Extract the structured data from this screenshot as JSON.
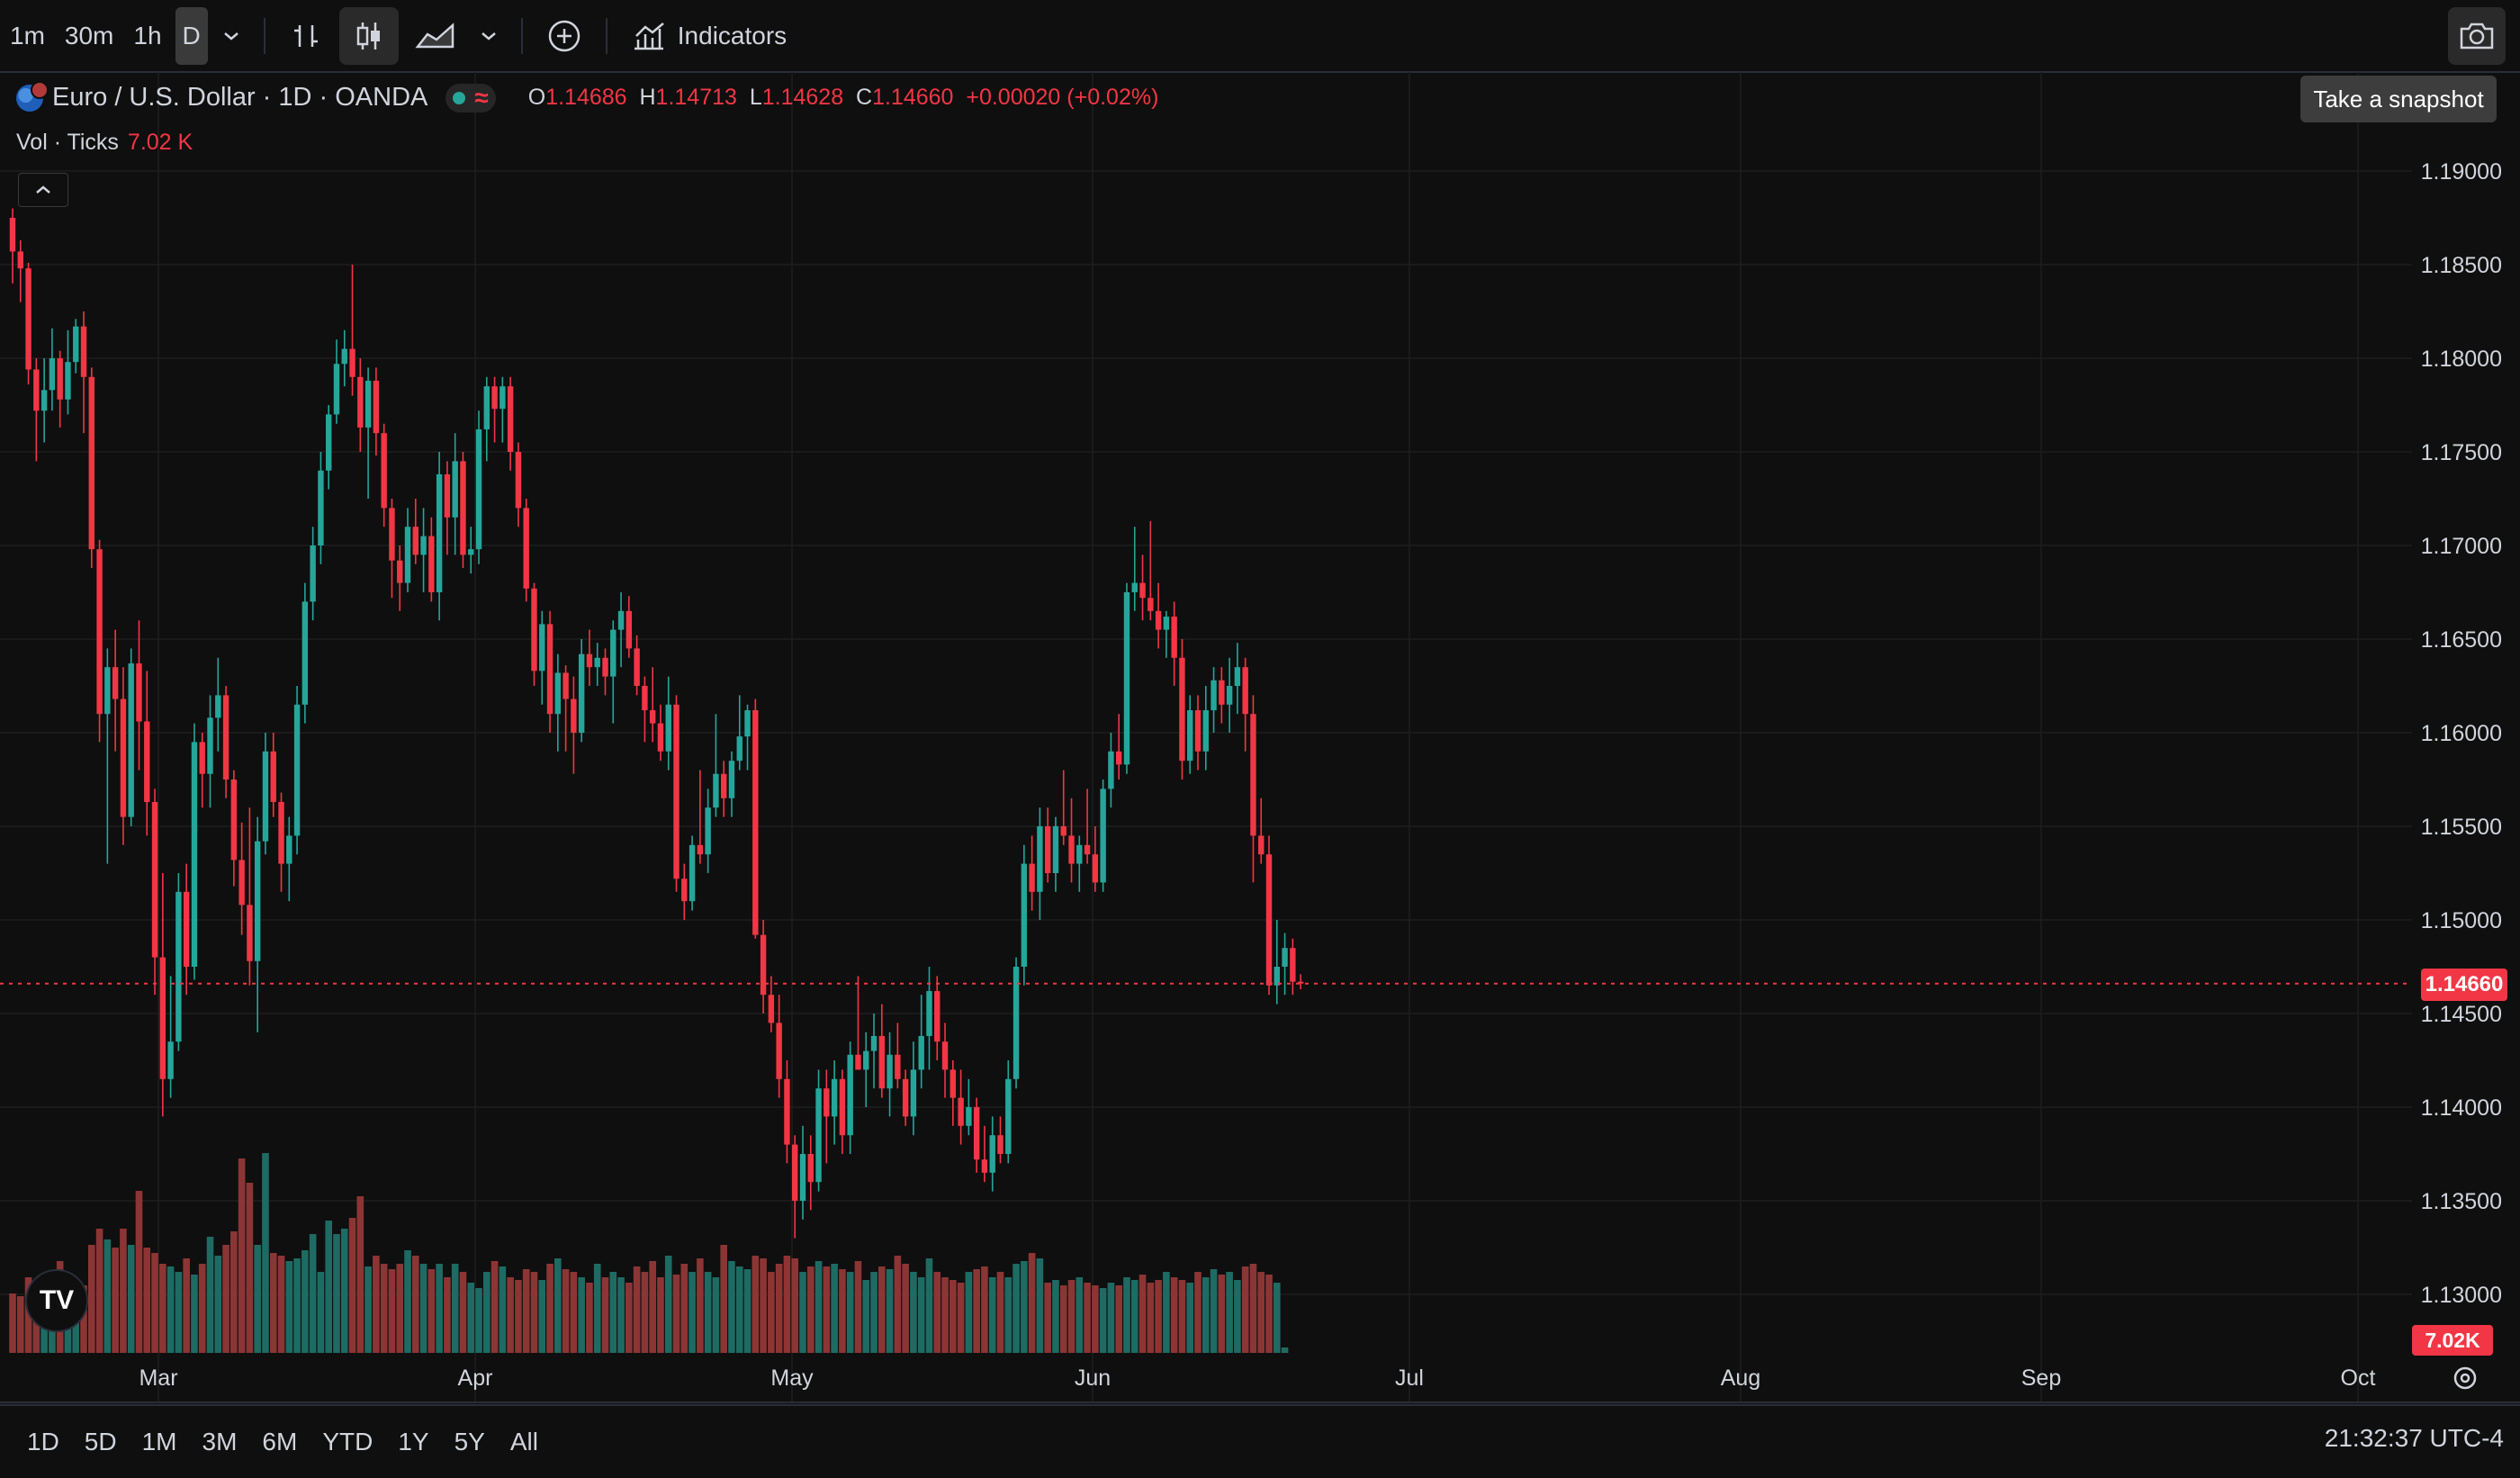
{
  "toolbar": {
    "timeframes": [
      "1m",
      "30m",
      "1h",
      "D"
    ],
    "indicators_label": "Indicators"
  },
  "snapshot_tooltip": "Take a snapshot",
  "legend": {
    "title": "Euro / U.S. Dollar · 1D · OANDA",
    "o_label": "O",
    "o": "1.14686",
    "h_label": "H",
    "h": "1.14713",
    "l_label": "L",
    "l": "1.14628",
    "c_label": "C",
    "c": "1.14660",
    "change": "+0.00020 (+0.02%)"
  },
  "volume_legend": {
    "label": "Vol · Ticks",
    "value": "7.02 K"
  },
  "price_axis": {
    "labels": [
      "1.19000",
      "1.18500",
      "1.18000",
      "1.17500",
      "1.17000",
      "1.16500",
      "1.16000",
      "1.15500",
      "1.15000",
      "1.14500",
      "1.14000",
      "1.13500",
      "1.13000"
    ],
    "last_price": "1.14660",
    "last_volume": "7.02K"
  },
  "time_axis": {
    "labels": [
      "Mar",
      "Apr",
      "May",
      "Jun",
      "Jul",
      "Aug",
      "Sep",
      "Oct"
    ]
  },
  "ranges": [
    "1D",
    "5D",
    "1M",
    "3M",
    "6M",
    "YTD",
    "1Y",
    "5Y",
    "All"
  ],
  "clock": "21:32:37 UTC-4",
  "tv_logo": "TV",
  "colors": {
    "up": "#26a69a",
    "down": "#f23645",
    "vol_up": "#1e6b63",
    "vol_down": "#8c3535",
    "grid": "#1e1e1e"
  },
  "chart_data": {
    "type": "candlestick",
    "symbol": "Euro / U.S. Dollar",
    "interval": "1D",
    "ylim": [
      1.128,
      1.192
    ],
    "y_ticks": [
      1.19,
      1.185,
      1.18,
      1.175,
      1.17,
      1.165,
      1.16,
      1.155,
      1.15,
      1.145,
      1.14,
      1.135,
      1.13
    ],
    "grid": true,
    "candles": [
      [
        1.1875,
        1.188,
        1.184,
        1.1857
      ],
      [
        1.1857,
        1.1863,
        1.183,
        1.1848
      ],
      [
        1.1848,
        1.1851,
        1.1786,
        1.1794
      ],
      [
        1.1794,
        1.18,
        1.1745,
        1.1772
      ],
      [
        1.1772,
        1.18,
        1.1755,
        1.1783
      ],
      [
        1.1783,
        1.1816,
        1.1772,
        1.18
      ],
      [
        1.18,
        1.1804,
        1.1763,
        1.1778
      ],
      [
        1.1778,
        1.1815,
        1.177,
        1.1798
      ],
      [
        1.1798,
        1.1821,
        1.1792,
        1.1817
      ],
      [
        1.1817,
        1.1825,
        1.176,
        1.179
      ],
      [
        1.179,
        1.1795,
        1.1688,
        1.1698
      ],
      [
        1.1698,
        1.1703,
        1.1595,
        1.161
      ],
      [
        1.161,
        1.1645,
        1.153,
        1.1635
      ],
      [
        1.1635,
        1.1655,
        1.159,
        1.1618
      ],
      [
        1.1618,
        1.1635,
        1.154,
        1.1555
      ],
      [
        1.1555,
        1.1645,
        1.155,
        1.1637
      ],
      [
        1.1637,
        1.166,
        1.158,
        1.1606
      ],
      [
        1.1606,
        1.1633,
        1.1545,
        1.1563
      ],
      [
        1.1563,
        1.157,
        1.146,
        1.148
      ],
      [
        1.148,
        1.1525,
        1.1395,
        1.1415
      ],
      [
        1.1415,
        1.147,
        1.1405,
        1.1435
      ],
      [
        1.1435,
        1.1525,
        1.143,
        1.1515
      ],
      [
        1.1515,
        1.153,
        1.146,
        1.1475
      ],
      [
        1.1475,
        1.1605,
        1.1468,
        1.1595
      ],
      [
        1.1595,
        1.16,
        1.156,
        1.1578
      ],
      [
        1.1578,
        1.162,
        1.156,
        1.1608
      ],
      [
        1.1608,
        1.164,
        1.159,
        1.162
      ],
      [
        1.162,
        1.1625,
        1.1565,
        1.1575
      ],
      [
        1.1575,
        1.158,
        1.1518,
        1.1532
      ],
      [
        1.1532,
        1.1552,
        1.1492,
        1.1508
      ],
      [
        1.1508,
        1.156,
        1.1465,
        1.1478
      ],
      [
        1.1478,
        1.1555,
        1.144,
        1.1542
      ],
      [
        1.1542,
        1.16,
        1.1535,
        1.159
      ],
      [
        1.159,
        1.16,
        1.1555,
        1.1563
      ],
      [
        1.1563,
        1.1568,
        1.1515,
        1.153
      ],
      [
        1.153,
        1.1555,
        1.151,
        1.1545
      ],
      [
        1.1545,
        1.1625,
        1.1535,
        1.1615
      ],
      [
        1.1615,
        1.168,
        1.1605,
        1.167
      ],
      [
        1.167,
        1.171,
        1.166,
        1.17
      ],
      [
        1.17,
        1.175,
        1.169,
        1.174
      ],
      [
        1.174,
        1.1775,
        1.173,
        1.177
      ],
      [
        1.177,
        1.181,
        1.1765,
        1.1797
      ],
      [
        1.1797,
        1.1815,
        1.1785,
        1.1805
      ],
      [
        1.1805,
        1.185,
        1.178,
        1.179
      ],
      [
        1.179,
        1.18,
        1.175,
        1.1763
      ],
      [
        1.1763,
        1.1795,
        1.1725,
        1.1788
      ],
      [
        1.1788,
        1.1795,
        1.1748,
        1.176
      ],
      [
        1.176,
        1.1765,
        1.171,
        1.172
      ],
      [
        1.172,
        1.1725,
        1.1672,
        1.1692
      ],
      [
        1.1692,
        1.17,
        1.1665,
        1.168
      ],
      [
        1.168,
        1.172,
        1.1675,
        1.171
      ],
      [
        1.171,
        1.1725,
        1.169,
        1.1695
      ],
      [
        1.1695,
        1.172,
        1.1675,
        1.1705
      ],
      [
        1.1705,
        1.1715,
        1.167,
        1.1675
      ],
      [
        1.1675,
        1.175,
        1.166,
        1.1738
      ],
      [
        1.1738,
        1.1745,
        1.1695,
        1.1715
      ],
      [
        1.1715,
        1.176,
        1.1695,
        1.1745
      ],
      [
        1.1745,
        1.175,
        1.1688,
        1.1695
      ],
      [
        1.1695,
        1.171,
        1.1685,
        1.1698
      ],
      [
        1.1698,
        1.1772,
        1.169,
        1.1762
      ],
      [
        1.1762,
        1.179,
        1.1745,
        1.1785
      ],
      [
        1.1785,
        1.179,
        1.1755,
        1.1773
      ],
      [
        1.1773,
        1.179,
        1.1755,
        1.1785
      ],
      [
        1.1785,
        1.179,
        1.174,
        1.175
      ],
      [
        1.175,
        1.1755,
        1.171,
        1.172
      ],
      [
        1.172,
        1.1725,
        1.167,
        1.1677
      ],
      [
        1.1677,
        1.168,
        1.1625,
        1.1633
      ],
      [
        1.1633,
        1.1665,
        1.1615,
        1.1658
      ],
      [
        1.1658,
        1.1665,
        1.16,
        1.161
      ],
      [
        1.161,
        1.1642,
        1.159,
        1.1632
      ],
      [
        1.1632,
        1.1636,
        1.159,
        1.1618
      ],
      [
        1.1618,
        1.163,
        1.1578,
        1.16
      ],
      [
        1.16,
        1.165,
        1.1595,
        1.1642
      ],
      [
        1.1642,
        1.1655,
        1.1625,
        1.1635
      ],
      [
        1.1635,
        1.1648,
        1.1625,
        1.164
      ],
      [
        1.164,
        1.1645,
        1.162,
        1.163
      ],
      [
        1.163,
        1.166,
        1.1605,
        1.1655
      ],
      [
        1.1655,
        1.1675,
        1.1635,
        1.1665
      ],
      [
        1.1665,
        1.1673,
        1.164,
        1.1645
      ],
      [
        1.1645,
        1.1652,
        1.162,
        1.1625
      ],
      [
        1.1625,
        1.163,
        1.1595,
        1.1612
      ],
      [
        1.1612,
        1.1635,
        1.1595,
        1.1605
      ],
      [
        1.1605,
        1.1615,
        1.1585,
        1.159
      ],
      [
        1.159,
        1.163,
        1.158,
        1.1615
      ],
      [
        1.1615,
        1.162,
        1.1515,
        1.1522
      ],
      [
        1.1522,
        1.153,
        1.15,
        1.151
      ],
      [
        1.151,
        1.1545,
        1.1505,
        1.154
      ],
      [
        1.154,
        1.158,
        1.153,
        1.1535
      ],
      [
        1.1535,
        1.157,
        1.1525,
        1.156
      ],
      [
        1.156,
        1.161,
        1.1555,
        1.1578
      ],
      [
        1.1578,
        1.1585,
        1.1555,
        1.1565
      ],
      [
        1.1565,
        1.159,
        1.1555,
        1.1585
      ],
      [
        1.1585,
        1.162,
        1.158,
        1.1598
      ],
      [
        1.1598,
        1.1615,
        1.158,
        1.1612
      ],
      [
        1.1612,
        1.1618,
        1.149,
        1.1492
      ],
      [
        1.1492,
        1.15,
        1.145,
        1.146
      ],
      [
        1.146,
        1.147,
        1.144,
        1.1445
      ],
      [
        1.1445,
        1.146,
        1.1405,
        1.1415
      ],
      [
        1.1415,
        1.1425,
        1.137,
        1.138
      ],
      [
        1.138,
        1.1385,
        1.133,
        1.135
      ],
      [
        1.135,
        1.139,
        1.134,
        1.1375
      ],
      [
        1.1375,
        1.1385,
        1.1345,
        1.136
      ],
      [
        1.136,
        1.142,
        1.1355,
        1.141
      ],
      [
        1.141,
        1.142,
        1.137,
        1.1395
      ],
      [
        1.1395,
        1.1425,
        1.138,
        1.1415
      ],
      [
        1.1415,
        1.142,
        1.1375,
        1.1385
      ],
      [
        1.1385,
        1.1435,
        1.1375,
        1.1428
      ],
      [
        1.1428,
        1.147,
        1.142,
        1.142
      ],
      [
        1.142,
        1.144,
        1.14,
        1.143
      ],
      [
        1.143,
        1.145,
        1.141,
        1.1438
      ],
      [
        1.1438,
        1.1455,
        1.1405,
        1.141
      ],
      [
        1.141,
        1.144,
        1.1395,
        1.1428
      ],
      [
        1.1428,
        1.1445,
        1.141,
        1.1415
      ],
      [
        1.1415,
        1.142,
        1.139,
        1.1395
      ],
      [
        1.1395,
        1.1435,
        1.1385,
        1.142
      ],
      [
        1.142,
        1.146,
        1.141,
        1.1438
      ],
      [
        1.1438,
        1.1475,
        1.142,
        1.1462
      ],
      [
        1.1462,
        1.147,
        1.1425,
        1.1435
      ],
      [
        1.1435,
        1.1445,
        1.1405,
        1.142
      ],
      [
        1.142,
        1.1425,
        1.139,
        1.1405
      ],
      [
        1.1405,
        1.142,
        1.138,
        1.139
      ],
      [
        1.139,
        1.1415,
        1.1385,
        1.14
      ],
      [
        1.14,
        1.1405,
        1.1365,
        1.1372
      ],
      [
        1.1372,
        1.139,
        1.136,
        1.1365
      ],
      [
        1.1365,
        1.1395,
        1.1355,
        1.1385
      ],
      [
        1.1385,
        1.1395,
        1.137,
        1.1375
      ],
      [
        1.1375,
        1.1425,
        1.137,
        1.1415
      ],
      [
        1.1415,
        1.148,
        1.141,
        1.1475
      ],
      [
        1.1475,
        1.154,
        1.1465,
        1.153
      ],
      [
        1.153,
        1.1545,
        1.1505,
        1.1515
      ],
      [
        1.1515,
        1.156,
        1.15,
        1.155
      ],
      [
        1.155,
        1.156,
        1.152,
        1.1525
      ],
      [
        1.1525,
        1.1555,
        1.1515,
        1.155
      ],
      [
        1.155,
        1.158,
        1.154,
        1.1545
      ],
      [
        1.1545,
        1.1565,
        1.152,
        1.153
      ],
      [
        1.153,
        1.1545,
        1.1515,
        1.154
      ],
      [
        1.154,
        1.157,
        1.153,
        1.1535
      ],
      [
        1.1535,
        1.155,
        1.1515,
        1.152
      ],
      [
        1.152,
        1.1575,
        1.1515,
        1.157
      ],
      [
        1.157,
        1.16,
        1.156,
        1.159
      ],
      [
        1.159,
        1.161,
        1.1575,
        1.1583
      ],
      [
        1.1583,
        1.168,
        1.1578,
        1.1675
      ],
      [
        1.1675,
        1.171,
        1.1665,
        1.168
      ],
      [
        1.168,
        1.1695,
        1.166,
        1.1672
      ],
      [
        1.1672,
        1.1713,
        1.166,
        1.1665
      ],
      [
        1.1665,
        1.168,
        1.1645,
        1.1655
      ],
      [
        1.1655,
        1.1665,
        1.164,
        1.1662
      ],
      [
        1.1662,
        1.167,
        1.1625,
        1.164
      ],
      [
        1.164,
        1.165,
        1.1575,
        1.1585
      ],
      [
        1.1585,
        1.162,
        1.1578,
        1.1612
      ],
      [
        1.1612,
        1.162,
        1.158,
        1.159
      ],
      [
        1.159,
        1.1625,
        1.158,
        1.1612
      ],
      [
        1.1612,
        1.1635,
        1.16,
        1.1628
      ],
      [
        1.1628,
        1.1635,
        1.1605,
        1.1615
      ],
      [
        1.1615,
        1.164,
        1.16,
        1.1625
      ],
      [
        1.1625,
        1.1648,
        1.161,
        1.1635
      ],
      [
        1.1635,
        1.164,
        1.159,
        1.161
      ],
      [
        1.161,
        1.162,
        1.152,
        1.1545
      ],
      [
        1.1545,
        1.1565,
        1.153,
        1.1535
      ],
      [
        1.1535,
        1.1545,
        1.146,
        1.1465
      ],
      [
        1.1465,
        1.15,
        1.1455,
        1.1475
      ],
      [
        1.1475,
        1.1493,
        1.146,
        1.1485
      ],
      [
        1.1485,
        1.149,
        1.146,
        1.1467
      ],
      [
        1.1467,
        1.1471,
        1.1463,
        1.1466
      ]
    ],
    "volume": {
      "last": 7020,
      "relative_heights": [
        0.22,
        0.21,
        0.28,
        0.23,
        0.17,
        0.24,
        0.34,
        0.21,
        0.26,
        0.25,
        0.4,
        0.46,
        0.42,
        0.39,
        0.46,
        0.4,
        0.6,
        0.39,
        0.37,
        0.33,
        0.32,
        0.3,
        0.35,
        0.29,
        0.33,
        0.43,
        0.36,
        0.4,
        0.45,
        0.72,
        0.63,
        0.4,
        0.74,
        0.37,
        0.36,
        0.34,
        0.35,
        0.38,
        0.44,
        0.3,
        0.49,
        0.44,
        0.46,
        0.5,
        0.58,
        0.32,
        0.36,
        0.33,
        0.31,
        0.33,
        0.38,
        0.36,
        0.33,
        0.31,
        0.33,
        0.28,
        0.33,
        0.3,
        0.26,
        0.24,
        0.3,
        0.34,
        0.32,
        0.28,
        0.27,
        0.31,
        0.3,
        0.27,
        0.33,
        0.35,
        0.31,
        0.3,
        0.28,
        0.26,
        0.33,
        0.28,
        0.3,
        0.28,
        0.26,
        0.32,
        0.3,
        0.34,
        0.28,
        0.36,
        0.29,
        0.33,
        0.3,
        0.35,
        0.3,
        0.28,
        0.4,
        0.34,
        0.32,
        0.31,
        0.36,
        0.35,
        0.3,
        0.33,
        0.36,
        0.35,
        0.3,
        0.32,
        0.34,
        0.32,
        0.33,
        0.31,
        0.3,
        0.34,
        0.27,
        0.3,
        0.32,
        0.31,
        0.36,
        0.33,
        0.3,
        0.28,
        0.35,
        0.3,
        0.28,
        0.27,
        0.26,
        0.3,
        0.31,
        0.32,
        0.28,
        0.3,
        0.28,
        0.33,
        0.34,
        0.37,
        0.35,
        0.26,
        0.27,
        0.25,
        0.27,
        0.28,
        0.26,
        0.25,
        0.24,
        0.26,
        0.25,
        0.28,
        0.27,
        0.29,
        0.26,
        0.27,
        0.3,
        0.28,
        0.27,
        0.26,
        0.3,
        0.28,
        0.31,
        0.29,
        0.3,
        0.27,
        0.32,
        0.33,
        0.3,
        0.29,
        0.26,
        0.02
      ]
    }
  }
}
